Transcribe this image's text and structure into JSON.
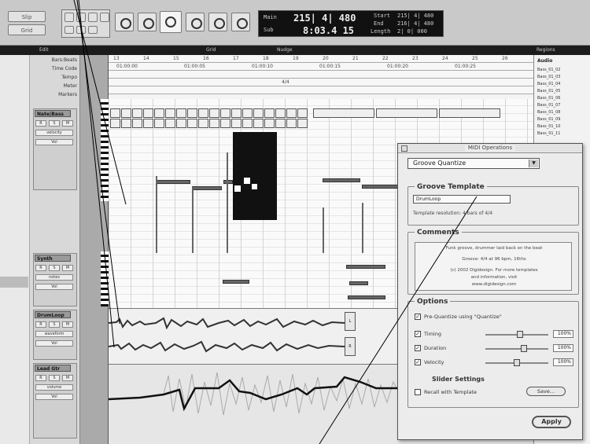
{
  "toolbar": {
    "mode_buttons": [
      "Slip",
      "Grid"
    ],
    "counter": {
      "main_label": "Main",
      "main_value": "215| 4| 480",
      "sub_label": "Sub",
      "sub_value": "8:03.4 15",
      "start_label": "Start",
      "start_value": "215| 4| 480",
      "end_label": "End",
      "end_value": "216| 4| 480",
      "length_label": "Length",
      "length_value": "2| 0| 000"
    }
  },
  "ruler_bar": {
    "edit_label": "Edit",
    "grid_label": "Grid",
    "nudge_label": "Nudge",
    "regions_label": "Regions"
  },
  "rulers": {
    "bars_beats_label": "Bars:Beats",
    "timecode_label": "Time Code",
    "tempo_label": "Tempo",
    "meter_label": "Meter",
    "markers_label": "Markers",
    "bar_numbers": [
      "13",
      "14",
      "15",
      "16",
      "17",
      "18",
      "19",
      "20",
      "21",
      "22",
      "23",
      "24",
      "25",
      "26"
    ],
    "timecode_values": [
      "01:00:00",
      "01:00:05",
      "01:00:10",
      "01:00:15",
      "01:00:20",
      "01:00:25"
    ],
    "meter_marker": "4/4"
  },
  "tracks": [
    {
      "name": "Nate|Bass",
      "volume_label": "Vol",
      "buttons": [
        "R",
        "S",
        "M"
      ],
      "extra_label": "velocity"
    },
    {
      "name": "Synth",
      "volume_label": "Vol",
      "buttons": [
        "R",
        "S",
        "M"
      ],
      "extra_label": "notes"
    },
    {
      "name": "DrumLoop",
      "volume_label": "Vol",
      "buttons": [
        "R",
        "S",
        "M"
      ],
      "extra_label": "waveform"
    },
    {
      "name": "Lead Gtr",
      "volume_label": "Vol",
      "buttons": [
        "R",
        "S",
        "M"
      ],
      "extra_label": "volume"
    }
  ],
  "region_list": {
    "title": "Audio",
    "items": [
      "Bass_01_02",
      "Bass_01_03",
      "Bass_01_04",
      "Bass_01_05",
      "Bass_01_06",
      "Bass_01_07",
      "Bass_01_08",
      "Bass_01_09",
      "Bass_01_10",
      "Bass_01_11"
    ]
  },
  "audio_clip_labels": [
    "L",
    "R"
  ],
  "midi_window": {
    "title": "MIDI Operations",
    "operation": "Groove Quantize",
    "groove_template": {
      "title": "Groove Template",
      "selected": "DrumLoop",
      "info": "Template resolution: 4 bars of 4/4"
    },
    "comments": {
      "title": "Comments",
      "lines": [
        "Funk groove, drummer laid back on the beat",
        "Groove: 4/4 at 96 bpm, 16ths",
        "(c) 2002 Digidesign. For more templates",
        "and information, visit",
        "www.digidesign.com"
      ]
    },
    "options": {
      "title": "Options",
      "pre_quantize": "Pre-Quantize using \"Quantize\"",
      "rows": [
        {
          "label": "Timing",
          "value": "100%",
          "level": 0.55
        },
        {
          "label": "Duration",
          "value": "100%",
          "level": 0.62
        },
        {
          "label": "Velocity",
          "value": "100%",
          "level": 0.5
        }
      ],
      "slider_settings_title": "Slider Settings",
      "recall_label": "Recall with Template",
      "save_button": "Save..."
    },
    "apply_button": "Apply"
  }
}
